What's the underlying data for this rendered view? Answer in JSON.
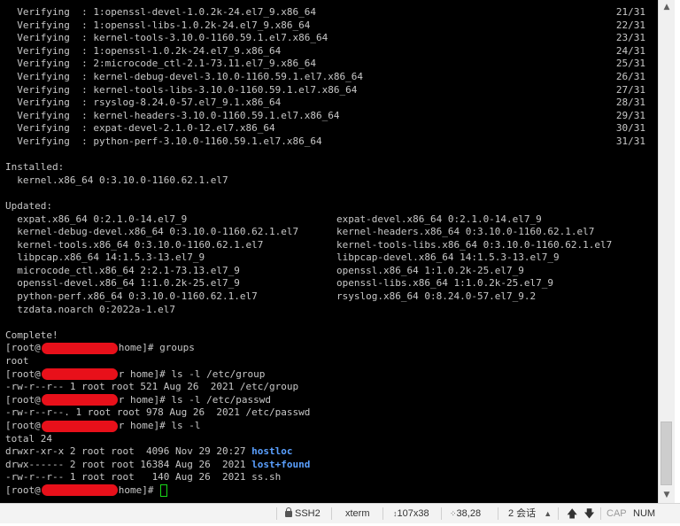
{
  "terminal": {
    "verifying": [
      {
        "text": "  Verifying  : 1:openssl-devel-1.0.2k-24.el7_9.x86_64",
        "count": "21/31"
      },
      {
        "text": "  Verifying  : 1:openssl-libs-1.0.2k-24.el7_9.x86_64",
        "count": "22/31"
      },
      {
        "text": "  Verifying  : kernel-tools-3.10.0-1160.59.1.el7.x86_64",
        "count": "23/31"
      },
      {
        "text": "  Verifying  : 1:openssl-1.0.2k-24.el7_9.x86_64",
        "count": "24/31"
      },
      {
        "text": "  Verifying  : 2:microcode_ctl-2.1-73.11.el7_9.x86_64",
        "count": "25/31"
      },
      {
        "text": "  Verifying  : kernel-debug-devel-3.10.0-1160.59.1.el7.x86_64",
        "count": "26/31"
      },
      {
        "text": "  Verifying  : kernel-tools-libs-3.10.0-1160.59.1.el7.x86_64",
        "count": "27/31"
      },
      {
        "text": "  Verifying  : rsyslog-8.24.0-57.el7_9.1.x86_64",
        "count": "28/31"
      },
      {
        "text": "  Verifying  : kernel-headers-3.10.0-1160.59.1.el7.x86_64",
        "count": "29/31"
      },
      {
        "text": "  Verifying  : expat-devel-2.1.0-12.el7.x86_64",
        "count": "30/31"
      },
      {
        "text": "  Verifying  : python-perf-3.10.0-1160.59.1.el7.x86_64",
        "count": "31/31"
      }
    ],
    "installed_header": "Installed:",
    "installed": [
      "  kernel.x86_64 0:3.10.0-1160.62.1.el7"
    ],
    "updated_header": "Updated:",
    "updated": [
      [
        "  expat.x86_64 0:2.1.0-14.el7_9",
        "expat-devel.x86_64 0:2.1.0-14.el7_9"
      ],
      [
        "  kernel-debug-devel.x86_64 0:3.10.0-1160.62.1.el7",
        "kernel-headers.x86_64 0:3.10.0-1160.62.1.el7"
      ],
      [
        "  kernel-tools.x86_64 0:3.10.0-1160.62.1.el7",
        "kernel-tools-libs.x86_64 0:3.10.0-1160.62.1.el7"
      ],
      [
        "  libpcap.x86_64 14:1.5.3-13.el7_9",
        "libpcap-devel.x86_64 14:1.5.3-13.el7_9"
      ],
      [
        "  microcode_ctl.x86_64 2:2.1-73.13.el7_9",
        "openssl.x86_64 1:1.0.2k-25.el7_9"
      ],
      [
        "  openssl-devel.x86_64 1:1.0.2k-25.el7_9",
        "openssl-libs.x86_64 1:1.0.2k-25.el7_9"
      ],
      [
        "  python-perf.x86_64 0:3.10.0-1160.62.1.el7",
        "rsyslog.x86_64 0:8.24.0-57.el7_9.2"
      ],
      [
        "  tzdata.noarch 0:2022a-1.el7",
        ""
      ]
    ],
    "complete": "Complete!",
    "session": [
      {
        "type": "prompt",
        "prefix": "[root@",
        "suffix": "home]# ",
        "cmd": "groups"
      },
      {
        "type": "out",
        "text": "root"
      },
      {
        "type": "prompt",
        "prefix": "[root@",
        "suffix": "r home]# ",
        "cmd": "ls -l /etc/group"
      },
      {
        "type": "out",
        "text": "-rw-r--r-- 1 root root 521 Aug 26  2021 /etc/group"
      },
      {
        "type": "prompt",
        "prefix": "[root@",
        "suffix": "r home]# ",
        "cmd": "ls -l /etc/passwd"
      },
      {
        "type": "out",
        "text": "-rw-r--r--. 1 root root 978 Aug 26  2021 /etc/passwd"
      },
      {
        "type": "prompt",
        "prefix": "[root@",
        "suffix": "r home]# ",
        "cmd": "ls -l"
      },
      {
        "type": "out",
        "text": "total 24"
      },
      {
        "type": "ls",
        "text": "drwxr-xr-x 2 root root  4096 Nov 29 20:27 ",
        "name": "hostloc",
        "dir": true
      },
      {
        "type": "ls",
        "text": "drwx------ 2 root root 16384 Aug 26  2021 ",
        "name": "lost+found",
        "dir": true
      },
      {
        "type": "ls",
        "text": "-rw-r--r-- 1 root root   140 Aug 26  2021 ",
        "name": "ss.sh",
        "dir": false
      },
      {
        "type": "prompt",
        "prefix": "[root@",
        "suffix": "home]# ",
        "cmd": "",
        "cursor": true
      }
    ]
  },
  "statusbar": {
    "protocol": "SSH2",
    "terminal_type": "xterm",
    "size": "107x38",
    "position": "38,28",
    "sessions": "2 会话",
    "caps": "CAP",
    "num": "NUM"
  },
  "colors": {
    "background": "#000000",
    "text": "#c8c8c8",
    "directory": "#5aa0ff",
    "redaction": "#e8101a",
    "cursor": "#19d719"
  }
}
